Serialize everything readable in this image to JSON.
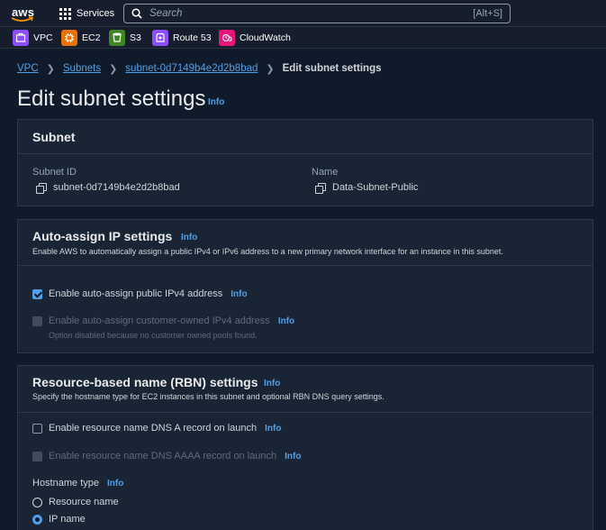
{
  "topbar": {
    "logo_text": "aws",
    "services_label": "Services",
    "search_placeholder": "Search",
    "search_shortcut": "[Alt+S]"
  },
  "favorites": [
    {
      "label": "VPC",
      "color": "#8c4fff",
      "icon": "vpc-icon"
    },
    {
      "label": "EC2",
      "color": "#ed7100",
      "icon": "ec2-icon"
    },
    {
      "label": "S3",
      "color": "#3f8624",
      "icon": "s3-icon"
    },
    {
      "label": "Route 53",
      "color": "#8c4fff",
      "icon": "route53-icon"
    },
    {
      "label": "CloudWatch",
      "color": "#e7157b",
      "icon": "cloudwatch-icon"
    }
  ],
  "breadcrumb": {
    "items": [
      "VPC",
      "Subnets",
      "subnet-0d7149b4e2d2b8bad"
    ],
    "current": "Edit subnet settings"
  },
  "page": {
    "title": "Edit subnet settings",
    "info": "Info"
  },
  "subnet_panel": {
    "title": "Subnet",
    "id_label": "Subnet ID",
    "id_value": "subnet-0d7149b4e2d2b8bad",
    "name_label": "Name",
    "name_value": "Data-Subnet-Public"
  },
  "auto_assign": {
    "title": "Auto-assign IP settings",
    "info": "Info",
    "description": "Enable AWS to automatically assign a public IPv4 or IPv6 address to a new primary network interface for an instance in this subnet.",
    "options": [
      {
        "label": "Enable auto-assign public IPv4 address",
        "checked": true,
        "disabled": false,
        "info": "Info"
      },
      {
        "label": "Enable auto-assign customer-owned IPv4 address",
        "checked": false,
        "disabled": true,
        "info": "Info",
        "hint": "Option disabled because no customer owned pools found."
      }
    ]
  },
  "rbn": {
    "title": "Resource-based name (RBN) settings",
    "info": "Info",
    "description": "Specify the hostname type for EC2 instances in this subnet and optional RBN DNS query settings.",
    "options": [
      {
        "label": "Enable resource name DNS A record on launch",
        "checked": false,
        "disabled": false,
        "info": "Info"
      },
      {
        "label": "Enable resource name DNS AAAA record on launch",
        "checked": false,
        "disabled": true,
        "info": "Info"
      }
    ],
    "hostname_type_label": "Hostname type",
    "hostname_info": "Info",
    "hostname_options": [
      {
        "label": "Resource name",
        "selected": false
      },
      {
        "label": "IP name",
        "selected": true
      }
    ]
  },
  "colors": {
    "link": "#539fe5",
    "background": "#0f1b2a",
    "panel": "#192534"
  }
}
